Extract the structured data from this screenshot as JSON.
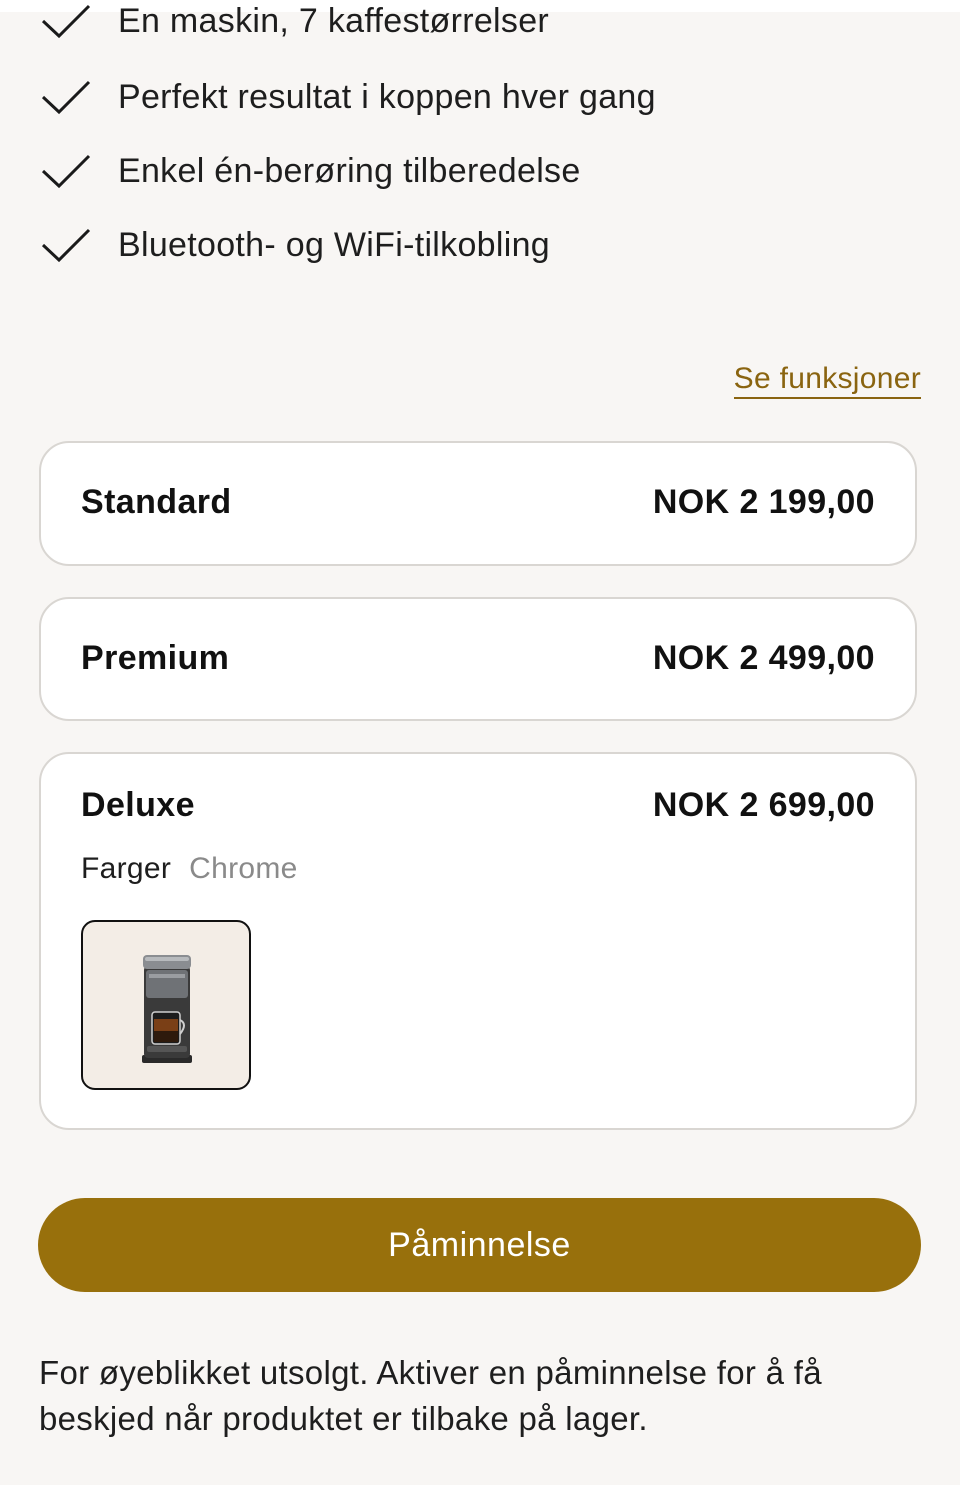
{
  "features": [
    "En maskin, 7 kaffestørrelser",
    "Perfekt resultat i koppen hver gang",
    "Enkel én-berøring tilberedelse",
    "Bluetooth- og WiFi-tilkobling"
  ],
  "see_features_link": "Se funksjoner",
  "variants": [
    {
      "name": "Standard",
      "price": "NOK 2 199,00"
    },
    {
      "name": "Premium",
      "price": "NOK 2 499,00"
    },
    {
      "name": "Deluxe",
      "price": "NOK 2 699,00"
    }
  ],
  "colors": {
    "label": "Farger",
    "selected": "Chrome"
  },
  "reminder_button": "Påminnelse",
  "stock_notice": "For øyeblikket utsolgt. Aktiver en påminnelse for å få beskjed når produktet er tilbake på lager.",
  "theme": {
    "accent": "#98700c",
    "link": "#8a6410",
    "background": "#f8f6f4"
  }
}
